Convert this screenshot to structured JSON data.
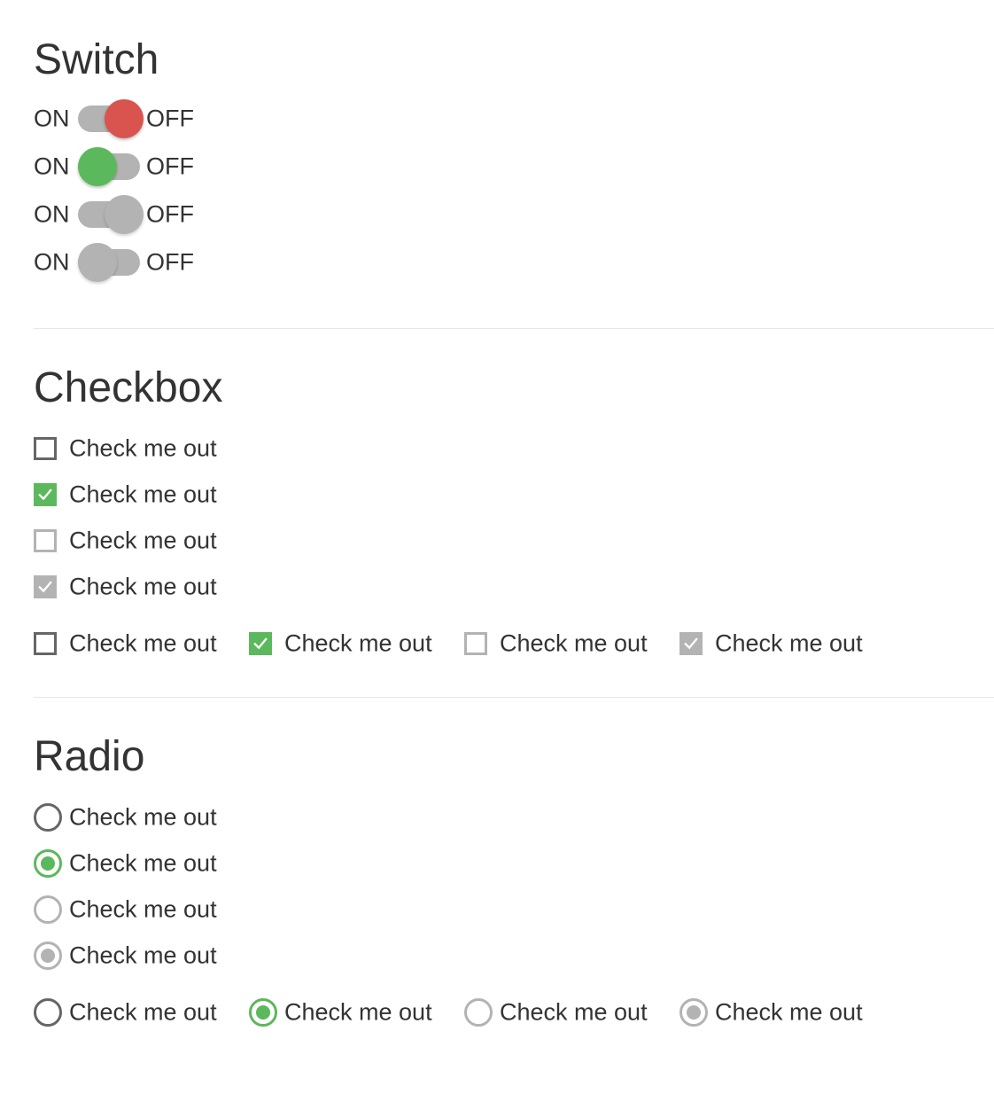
{
  "sections": {
    "switch": {
      "title": "Switch",
      "rows": [
        {
          "on_label": "ON",
          "off_label": "OFF",
          "state": "off",
          "enabled": true,
          "knob_color": "#d9534f",
          "track_color": "#b3b3b3"
        },
        {
          "on_label": "ON",
          "off_label": "OFF",
          "state": "on",
          "enabled": true,
          "knob_color": "#5cb85c",
          "track_color": "#b3b3b3"
        },
        {
          "on_label": "ON",
          "off_label": "OFF",
          "state": "off",
          "enabled": false,
          "knob_color": "#b3b3b3",
          "track_color": "#b3b3b3"
        },
        {
          "on_label": "ON",
          "off_label": "OFF",
          "state": "on",
          "enabled": false,
          "knob_color": "#b3b3b3",
          "track_color": "#b3b3b3"
        }
      ]
    },
    "checkbox": {
      "title": "Checkbox",
      "stacked": [
        {
          "label": "Check me out",
          "checked": false,
          "disabled": false
        },
        {
          "label": "Check me out",
          "checked": true,
          "disabled": false
        },
        {
          "label": "Check me out",
          "checked": false,
          "disabled": true
        },
        {
          "label": "Check me out",
          "checked": true,
          "disabled": true
        }
      ],
      "inline": [
        {
          "label": "Check me out",
          "checked": false,
          "disabled": false
        },
        {
          "label": "Check me out",
          "checked": true,
          "disabled": false
        },
        {
          "label": "Check me out",
          "checked": false,
          "disabled": true
        },
        {
          "label": "Check me out",
          "checked": true,
          "disabled": true
        }
      ]
    },
    "radio": {
      "title": "Radio",
      "stacked": [
        {
          "label": "Check me out",
          "checked": false,
          "disabled": false
        },
        {
          "label": "Check me out",
          "checked": true,
          "disabled": false
        },
        {
          "label": "Check me out",
          "checked": false,
          "disabled": true
        },
        {
          "label": "Check me out",
          "checked": true,
          "disabled": true
        }
      ],
      "inline": [
        {
          "label": "Check me out",
          "checked": false,
          "disabled": false
        },
        {
          "label": "Check me out",
          "checked": true,
          "disabled": false
        },
        {
          "label": "Check me out",
          "checked": false,
          "disabled": true
        },
        {
          "label": "Check me out",
          "checked": true,
          "disabled": true
        }
      ]
    }
  },
  "colors": {
    "accent_green": "#5cb85c",
    "accent_red": "#d9534f",
    "disabled_gray": "#b3b3b3",
    "border_dark": "#666666",
    "text": "#333333"
  }
}
